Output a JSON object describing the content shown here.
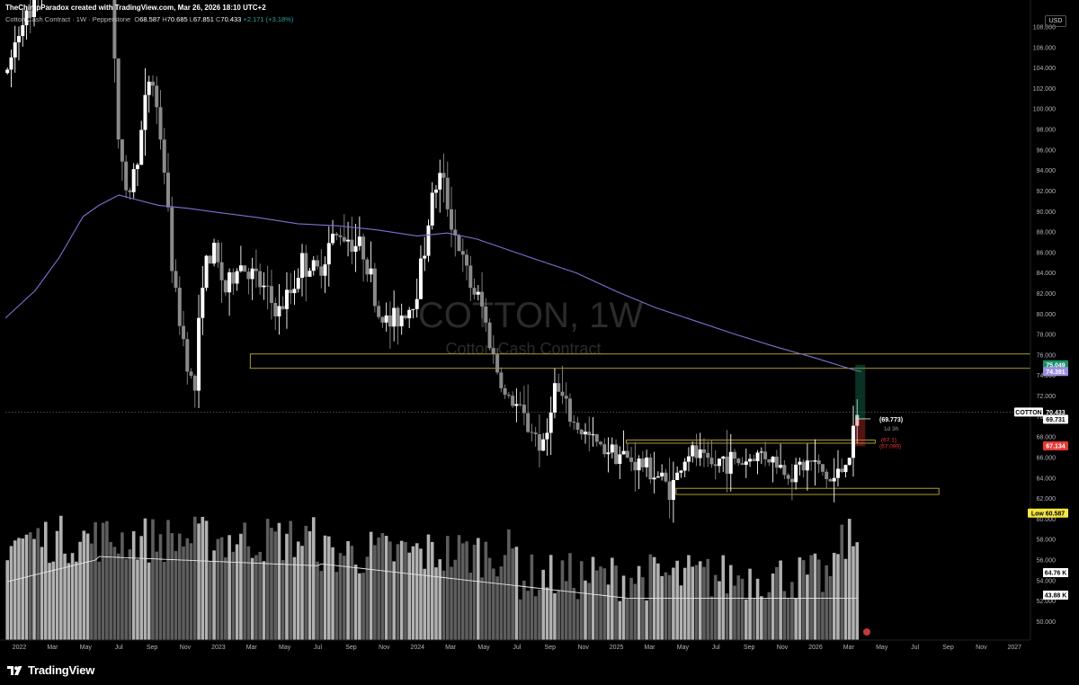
{
  "header": {
    "credit": "TheChimpParadox created with TradingView.com, Mar 26, 2026 18:10 UTC+2",
    "instrument": "Cotton Cash Contract · 1W · Pepperstone",
    "open_label": "O",
    "open": "68.587",
    "high_label": "H",
    "high": "70.685",
    "low_label": "L",
    "low": "67.851",
    "close_label": "C",
    "close": "70.433",
    "change": "+2.171 (+3.18%)"
  },
  "currency": "USD",
  "watermark": {
    "symbol": "COTTON, 1W",
    "name": "Cotton Cash Contract"
  },
  "footer": {
    "brand": "TradingView"
  },
  "colors": {
    "background": "#000000",
    "candle_up": "#ffffff",
    "candle_down": "#8a8a8a",
    "ma_line": "#7b72d6",
    "zone_border": "#d6c23a",
    "last_price_bg": "#ffffff",
    "stop_red": "#e53935",
    "target_green": "#1b8f6a",
    "ma_label_bg": "#9c8fe0",
    "low_label_bg": "#f5e642"
  },
  "chart_data": {
    "type": "candlestick",
    "timeframe": "1W",
    "x_ticks": [
      "2022",
      "Mar",
      "May",
      "Jul",
      "Sep",
      "Nov",
      "2023",
      "Mar",
      "May",
      "Jul",
      "Sep",
      "Nov",
      "2024",
      "Mar",
      "May",
      "Jul",
      "Sep",
      "Nov",
      "2025",
      "Mar",
      "May",
      "Jul",
      "Sep",
      "Nov",
      "2026",
      "Mar",
      "May",
      "Jul",
      "Sep",
      "Nov",
      "2027"
    ],
    "y_ticks": [
      50,
      52,
      54,
      56,
      58,
      60,
      62,
      64,
      66,
      68,
      70,
      72,
      74,
      76,
      78,
      80,
      82,
      84,
      86,
      88,
      90,
      92,
      94,
      96,
      98,
      100,
      102,
      104,
      106,
      108
    ],
    "ylim": [
      48.2,
      110.1
    ],
    "x_range": [
      2021.93,
      2027.08
    ],
    "price_waypoints": [
      [
        2021.94,
        103.5
      ],
      [
        2021.98,
        106.5
      ],
      [
        2022.02,
        109.5
      ],
      [
        2022.05,
        108
      ],
      [
        2022.12,
        113
      ],
      [
        2022.18,
        118
      ],
      [
        2022.24,
        124
      ],
      [
        2022.3,
        132
      ],
      [
        2022.36,
        136
      ],
      [
        2022.4,
        125
      ],
      [
        2022.46,
        114
      ],
      [
        2022.5,
        96
      ],
      [
        2022.54,
        91
      ],
      [
        2022.6,
        96
      ],
      [
        2022.66,
        104
      ],
      [
        2022.72,
        96
      ],
      [
        2022.78,
        82
      ],
      [
        2022.84,
        76
      ],
      [
        2022.88,
        72
      ],
      [
        2022.92,
        84
      ],
      [
        2022.98,
        86
      ],
      [
        2023.04,
        82
      ],
      [
        2023.1,
        85
      ],
      [
        2023.16,
        84
      ],
      [
        2023.24,
        82
      ],
      [
        2023.3,
        80
      ],
      [
        2023.36,
        82
      ],
      [
        2023.42,
        85
      ],
      [
        2023.5,
        84
      ],
      [
        2023.56,
        87
      ],
      [
        2023.62,
        88
      ],
      [
        2023.68,
        87
      ],
      [
        2023.74,
        86
      ],
      [
        2023.8,
        80
      ],
      [
        2023.86,
        79
      ],
      [
        2023.92,
        80
      ],
      [
        2023.98,
        81
      ],
      [
        2024.04,
        87
      ],
      [
        2024.08,
        92
      ],
      [
        2024.12,
        93.5
      ],
      [
        2024.16,
        90
      ],
      [
        2024.2,
        87
      ],
      [
        2024.26,
        83
      ],
      [
        2024.32,
        81
      ],
      [
        2024.38,
        76
      ],
      [
        2024.44,
        72
      ],
      [
        2024.5,
        71
      ],
      [
        2024.56,
        69
      ],
      [
        2024.6,
        68
      ],
      [
        2024.64,
        66.5
      ],
      [
        2024.68,
        73
      ],
      [
        2024.72,
        72
      ],
      [
        2024.76,
        70
      ],
      [
        2024.8,
        69
      ],
      [
        2024.86,
        68
      ],
      [
        2024.92,
        67
      ],
      [
        2024.98,
        67
      ],
      [
        2025.04,
        66
      ],
      [
        2025.1,
        65.5
      ],
      [
        2025.16,
        65
      ],
      [
        2025.22,
        64
      ],
      [
        2025.28,
        63
      ],
      [
        2025.32,
        65
      ],
      [
        2025.36,
        66.5
      ],
      [
        2025.42,
        66
      ],
      [
        2025.48,
        65
      ],
      [
        2025.54,
        66
      ],
      [
        2025.62,
        65.5
      ],
      [
        2025.68,
        66
      ],
      [
        2025.74,
        66.5
      ],
      [
        2025.8,
        65.5
      ],
      [
        2025.86,
        64.5
      ],
      [
        2025.92,
        65
      ],
      [
        2025.98,
        65.5
      ],
      [
        2026.04,
        64.5
      ],
      [
        2026.08,
        63.5
      ],
      [
        2026.12,
        64.5
      ],
      [
        2026.16,
        66
      ],
      [
        2026.2,
        68.6
      ],
      [
        2026.22,
        70.4
      ]
    ],
    "sma": [
      [
        2021.93,
        79.6
      ],
      [
        2022.08,
        82.3
      ],
      [
        2022.2,
        85.5
      ],
      [
        2022.32,
        89.5
      ],
      [
        2022.4,
        90.6
      ],
      [
        2022.5,
        91.6
      ],
      [
        2022.58,
        91.2
      ],
      [
        2022.7,
        90.6
      ],
      [
        2022.85,
        90.3
      ],
      [
        2023.0,
        89.9
      ],
      [
        2023.2,
        89.4
      ],
      [
        2023.4,
        88.8
      ],
      [
        2023.6,
        88.6
      ],
      [
        2023.8,
        88.2
      ],
      [
        2024.0,
        87.6
      ],
      [
        2024.15,
        87.9
      ],
      [
        2024.3,
        87.3
      ],
      [
        2024.45,
        86.3
      ],
      [
        2024.6,
        85.3
      ],
      [
        2024.8,
        84.0
      ],
      [
        2025.0,
        82.2
      ],
      [
        2025.2,
        80.6
      ],
      [
        2025.4,
        79.3
      ],
      [
        2025.6,
        78.0
      ],
      [
        2025.8,
        76.8
      ],
      [
        2026.0,
        75.7
      ],
      [
        2026.2,
        74.5
      ],
      [
        2026.23,
        74.39
      ]
    ],
    "zones": [
      {
        "x0": 2023.16,
        "x1": 2027.08,
        "y0": 74.7,
        "y1": 76.1
      },
      {
        "x0": 2025.05,
        "x1": 2026.3,
        "y0": 67.4,
        "y1": 67.7
      },
      {
        "x0": 2025.3,
        "x1": 2026.62,
        "y0": 62.4,
        "y1": 63.0
      }
    ],
    "position_tool": {
      "x0": 2026.2,
      "x1": 2026.25,
      "entry": 69.773,
      "entry_label": "(69.773)",
      "countdown": "1d 3h",
      "target": 75.049,
      "stop": 67.099,
      "stop_label_1": "(67.1)",
      "stop_label_2": "(67.099)"
    },
    "price_labels": {
      "symbol": "COTTON",
      "last": "70.433",
      "level_1": "69.731",
      "stop_tag": "67.134",
      "target_tag": "75.049",
      "ma_tag": "74.391",
      "low_label": "Low",
      "low": "60.587"
    },
    "volume": {
      "ylim": [
        0,
        100
      ],
      "ma_label": "64.76 K",
      "last_label": "43.88 K"
    }
  }
}
